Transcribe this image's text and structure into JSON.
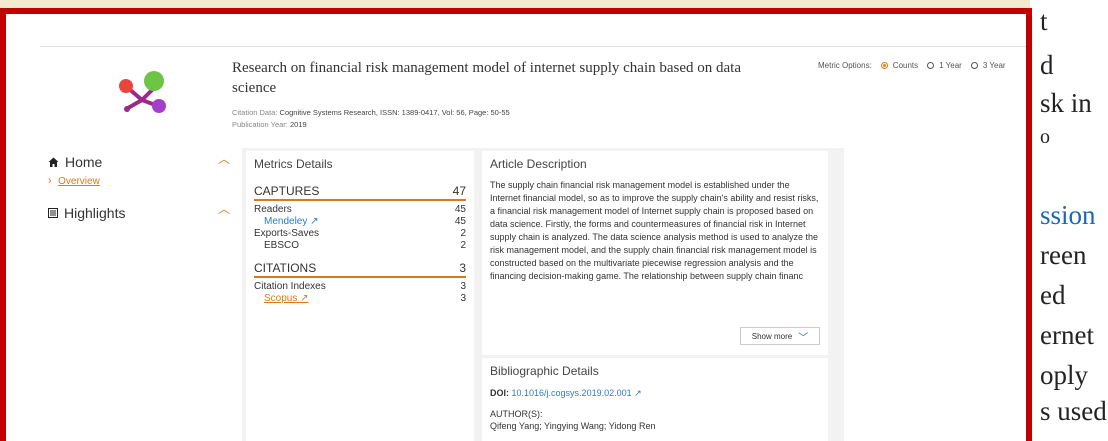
{
  "background_text": {
    "lines": [
      "t",
      "d",
      "sk in",
      "o",
      "ssion",
      "reen",
      "ed",
      "ernet",
      "oply",
      "s used"
    ]
  },
  "header": {
    "title": "Research on financial risk management model of internet supply chain based on data science",
    "citation_label": "Citation Data:",
    "citation_value": "Cognitive Systems Research, ISSN: 1389-0417, Vol: 56, Page: 50-55",
    "pubyear_label": "Publication Year:",
    "pubyear_value": "2019"
  },
  "metric_options": {
    "label": "Metric Options:",
    "options": [
      {
        "label": "Counts",
        "selected": true
      },
      {
        "label": "1 Year",
        "selected": false
      },
      {
        "label": "3 Year",
        "selected": false
      }
    ]
  },
  "nav": {
    "home": "Home",
    "overview": "Overview",
    "highlights": "Highlights",
    "icons": {
      "home": "home-icon",
      "highlights": "list-icon"
    }
  },
  "metrics": {
    "title": "Metrics Details",
    "captures": {
      "label": "CAPTURES",
      "value": "47"
    },
    "readers": {
      "label": "Readers",
      "value": "45"
    },
    "mendeley": {
      "label": "Mendeley ↗",
      "value": "45"
    },
    "exports": {
      "label": "Exports-Saves",
      "value": "2"
    },
    "ebsco": {
      "label": "EBSCO",
      "value": "2"
    },
    "citations": {
      "label": "CITATIONS",
      "value": "3"
    },
    "indexes": {
      "label": "Citation Indexes",
      "value": "3"
    },
    "scopus": {
      "label": "Scopus ↗",
      "value": "3"
    }
  },
  "article": {
    "title": "Article Description",
    "text": "The supply chain financial risk management model is established under the Internet financial model, so as to improve the supply chain's ability and resist risks, a financial risk management model of Internet supply chain is proposed based on data science. Firstly, the forms and countermeasures of financial risk in Internet supply chain is analyzed. The data science analysis method is used to analyze the risk management model, and the supply chain financial risk management model is constructed based on the multivariate piecewise regression analysis and the financing decision-making game. The relationship between supply chain financ",
    "show_more": "Show more"
  },
  "biblio": {
    "title": "Bibliographic Details",
    "doi_label": "DOI:",
    "doi_value": "10.1016/j.cogsys.2019.02.001 ↗",
    "authors_label": "AUTHOR(S):",
    "authors_value": "Qifeng Yang; Yingying Wang; Yidong Ren"
  },
  "colors": {
    "frame": "#c30000",
    "accent": "#d97a1a",
    "link": "#2b7cc9"
  }
}
